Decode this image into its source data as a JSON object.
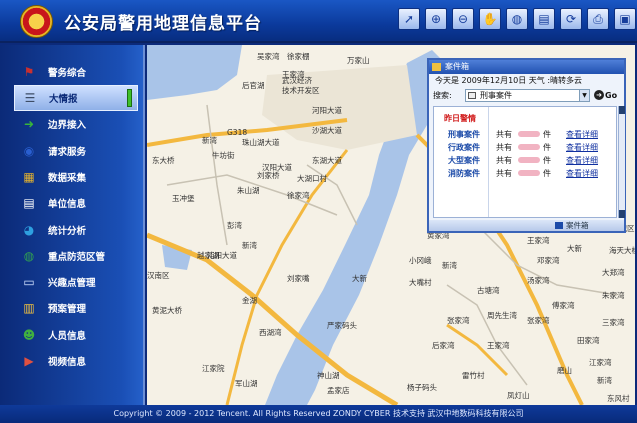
{
  "header": {
    "title": "公安局警用地理信息平台",
    "emblem_icon": "police-emblem-icon",
    "tools": [
      {
        "name": "pointer-tool-icon",
        "glyph": "➚"
      },
      {
        "name": "zoom-in-icon",
        "glyph": "⊕"
      },
      {
        "name": "zoom-out-icon",
        "glyph": "⊖"
      },
      {
        "name": "pan-hand-icon",
        "glyph": "✋"
      },
      {
        "name": "globe-icon",
        "glyph": "◍"
      },
      {
        "name": "layers-icon",
        "glyph": "▤"
      },
      {
        "name": "refresh-icon",
        "glyph": "⟳"
      },
      {
        "name": "print-icon",
        "glyph": "⎙"
      },
      {
        "name": "fullscreen-icon",
        "glyph": "▣"
      }
    ]
  },
  "sidebar": {
    "items": [
      {
        "label": "警务综合",
        "icon": "flag-icon",
        "glyph": "⚑",
        "color": "#c93030",
        "active": false
      },
      {
        "label": "大情报",
        "icon": "report-icon",
        "glyph": "☰",
        "color": "#3d4d66",
        "active": true
      },
      {
        "label": "边界接入",
        "icon": "arrow-right-icon",
        "glyph": "➜",
        "color": "#39b53a",
        "active": false
      },
      {
        "label": "请求服务",
        "icon": "network-icon",
        "glyph": "◉",
        "color": "#2a5fd0",
        "active": false
      },
      {
        "label": "数据采集",
        "icon": "folder-icon",
        "glyph": "▦",
        "color": "#e0b030",
        "active": false
      },
      {
        "label": "单位信息",
        "icon": "document-icon",
        "glyph": "▤",
        "color": "#ffffff",
        "active": false
      },
      {
        "label": "统计分析",
        "icon": "pie-chart-icon",
        "glyph": "◕",
        "color": "#2ea0e0",
        "active": false
      },
      {
        "label": "重点防范区管",
        "icon": "globe-icon",
        "glyph": "◍",
        "color": "#30a050",
        "active": false
      },
      {
        "label": "兴趣点管理",
        "icon": "monitor-icon",
        "glyph": "▭",
        "color": "#cfe0ff",
        "active": false
      },
      {
        "label": "预案管理",
        "icon": "book-icon",
        "glyph": "▥",
        "color": "#f0c040",
        "active": false
      },
      {
        "label": "人员信息",
        "icon": "people-icon",
        "glyph": "☻",
        "color": "#40b040",
        "active": false
      },
      {
        "label": "视频信息",
        "icon": "video-icon",
        "glyph": "▶",
        "color": "#e05040",
        "active": false
      }
    ]
  },
  "map": {
    "labels": [
      {
        "text": "吴家湾"
      },
      {
        "text": "徐家棚"
      },
      {
        "text": "万家山"
      },
      {
        "text": "后官湖"
      },
      {
        "text": "武汉经济"
      },
      {
        "text": "技术开发区"
      },
      {
        "text": "G318"
      },
      {
        "text": "珠山湖大道"
      },
      {
        "text": "王家湾"
      },
      {
        "text": "沙湖大道"
      },
      {
        "text": "东湖大道"
      },
      {
        "text": "河阳大道"
      },
      {
        "text": "汉阳大道"
      },
      {
        "text": "沌阳大道"
      },
      {
        "text": "新湾"
      },
      {
        "text": "牛坊街"
      },
      {
        "text": "刘家桥"
      },
      {
        "text": "朱山湖"
      },
      {
        "text": "大湖口村"
      },
      {
        "text": "徐家湾"
      },
      {
        "text": "玉冲堡"
      },
      {
        "text": "彭湾"
      },
      {
        "text": "东大桥"
      },
      {
        "text": "新湾"
      },
      {
        "text": "越家湖"
      },
      {
        "text": "汉南区"
      },
      {
        "text": "刘家嘴"
      },
      {
        "text": "大新"
      },
      {
        "text": "金湖"
      },
      {
        "text": "黄泥大桥"
      },
      {
        "text": "西湖湾"
      },
      {
        "text": "严家码头"
      },
      {
        "text": "江家院"
      },
      {
        "text": "军山湖"
      },
      {
        "text": "神山湖"
      },
      {
        "text": "孟家店"
      },
      {
        "text": "杨子码头"
      },
      {
        "text": "雷竹村"
      },
      {
        "text": "凤灯山"
      },
      {
        "text": "小冈峨"
      },
      {
        "text": "大嘴村"
      },
      {
        "text": "古塘湾"
      },
      {
        "text": "周先生湾"
      },
      {
        "text": "汤家湾"
      },
      {
        "text": "后家湾"
      },
      {
        "text": "黄家湾"
      },
      {
        "text": "张家湾"
      },
      {
        "text": "大新"
      },
      {
        "text": "海天大楼"
      },
      {
        "text": "大郑湾"
      },
      {
        "text": "朱家湾"
      },
      {
        "text": "三家湾"
      },
      {
        "text": "傅家湾"
      },
      {
        "text": "田家湾"
      },
      {
        "text": "江家湾"
      },
      {
        "text": "磨山"
      },
      {
        "text": "王家湾"
      },
      {
        "text": "邓家湾"
      },
      {
        "text": "新湾"
      },
      {
        "text": "东风村"
      },
      {
        "text": "新湾"
      },
      {
        "text": "张家湾"
      },
      {
        "text": "王家湾"
      },
      {
        "text": "新城区"
      }
    ]
  },
  "panel": {
    "title": "案件箱",
    "weather_line": "今天是 2009年12月10日 天气 :晴转多云",
    "search_label": "搜索:",
    "search_value": "刑事案件",
    "go_label": "Go",
    "section_label": "昨日警情",
    "rows": [
      {
        "label": "刑事案件",
        "count": "共有",
        "unit": "件",
        "link": "查看详细"
      },
      {
        "label": "行政案件",
        "count": "共有",
        "unit": "件",
        "link": "查看详细"
      },
      {
        "label": "大型案件",
        "count": "共有",
        "unit": "件",
        "link": "查看详细"
      },
      {
        "label": "消防案件",
        "count": "共有",
        "unit": "件",
        "link": "查看详细"
      }
    ],
    "footer_label": "案件箱"
  },
  "footer": {
    "copyright": "Copyright © 2009 - 2012 Tencent. All Rights Reserved  ZONDY CYBER   技术支持 武汉中地数码科技有限公司"
  }
}
